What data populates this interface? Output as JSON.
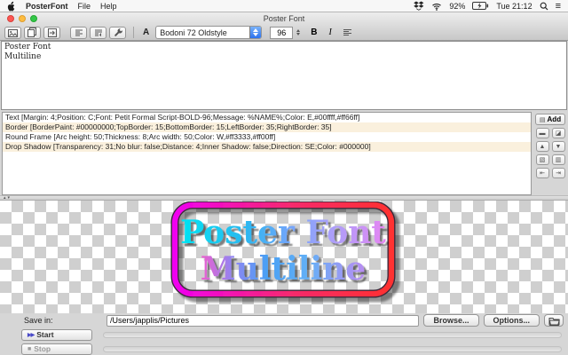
{
  "menu_bar": {
    "app_name": "PosterFont",
    "menu_file": "File",
    "menu_help": "Help",
    "battery": "92%",
    "clock": "Tue 21:12"
  },
  "window": {
    "title": "Poster Font"
  },
  "toolbar": {
    "font_field_label": "A",
    "font_name": "Bodoni 72 Oldstyle",
    "font_size": "96",
    "bold_label": "B",
    "italic_label": "I"
  },
  "editor": {
    "line1": "Poster Font",
    "line2": "Multiline"
  },
  "styles": {
    "add_label": "Add",
    "rows": [
      "Text [Margin: 4;Position: C;Font: Petit Formal Script-BOLD-96;Message: %NAME%;Color: E,#00ffff,#ff66ff]",
      "Border [BorderPaint: #00000000;TopBorder: 15;BottomBorder: 15;LeftBorder: 35;RightBorder: 35]",
      "Round Frame [Arc height: 50;Thickness: 8;Arc width: 50;Color: W,#ff3333,#ff00ff]",
      "Drop Shadow [Transparency: 31;No blur: false;Distance: 4;Inner Shadow: false;Direction: SE;Color: #000000]"
    ]
  },
  "preview": {
    "line1": "Poster Font",
    "line2": "Multiline",
    "frame_color_left": "#ff00ff",
    "frame_color_right": "#ff3333",
    "text_color_start": "#00ffff",
    "text_color_end": "#ff66ff"
  },
  "save_bar": {
    "label": "Save in:",
    "path": "/Users/japplis/Pictures",
    "browse_label": "Browse...",
    "options_label": "Options..."
  },
  "run_bar": {
    "start_label": "Start",
    "stop_label": "Stop"
  },
  "icons": {
    "add": "▤",
    "remove": "▬",
    "edit": "◪",
    "move_up": "▲",
    "move_down": "▼",
    "copy": "▧",
    "paste": "▥",
    "import": "⇤",
    "export": "⇥",
    "menu_extra": "≡",
    "divider_up": "▴",
    "divider_down": "▾",
    "start": "▶▶",
    "stop": "■"
  }
}
